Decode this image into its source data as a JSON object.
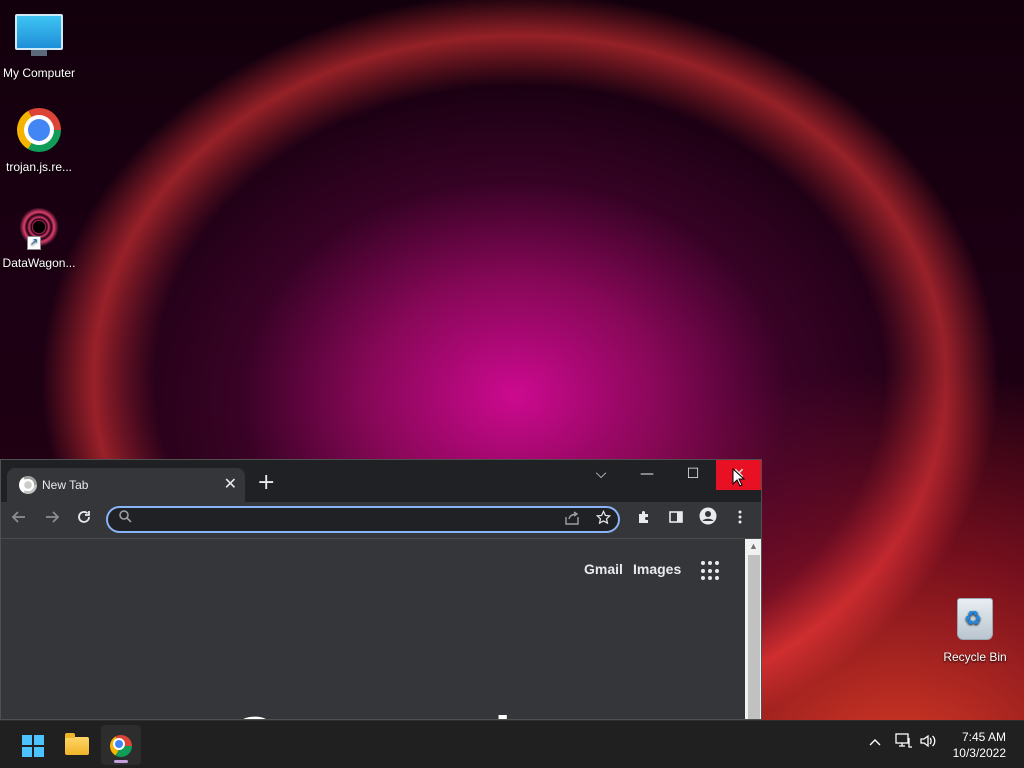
{
  "desktop": {
    "icons": [
      {
        "label": "My Computer"
      },
      {
        "label": "trojan.js.re..."
      },
      {
        "label": "DataWagon..."
      },
      {
        "label": "Recycle Bin"
      }
    ]
  },
  "browser": {
    "tab": {
      "title": "New Tab",
      "close": "✕"
    },
    "new_tab": "+",
    "controls": {
      "dropdown": "⌵",
      "minimize": "—",
      "maximize": "☐",
      "close": "✕"
    },
    "omnibox": {
      "value": "",
      "placeholder": ""
    },
    "page": {
      "links": [
        "Gmail",
        "Images"
      ],
      "logo_partial": "G l"
    }
  },
  "taskbar": {
    "apps": [
      "start",
      "file-explorer",
      "chrome"
    ],
    "tray": {
      "chevron": "^",
      "time": "7:45 AM",
      "date": "10/3/2022"
    }
  },
  "colors": {
    "close_red": "#e81123",
    "omnibox_focus": "#8ab4f8",
    "chrome_dark": "#35363a"
  }
}
